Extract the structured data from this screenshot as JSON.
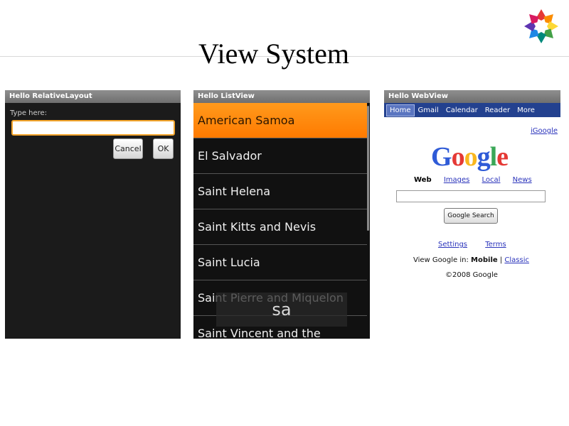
{
  "slide": {
    "title": "View System"
  },
  "relative_layout": {
    "title": "Hello RelativeLayout",
    "label": "Type here:",
    "input_value": "",
    "cancel_label": "Cancel",
    "ok_label": "OK"
  },
  "list_view": {
    "title": "Hello ListView",
    "items": [
      "American Samoa",
      "El Salvador",
      "Saint Helena",
      "Saint Kitts and Nevis",
      "Saint Lucia",
      "Saint Pierre and Miquelon",
      "Saint Vincent and the"
    ],
    "selected_item": "American Samoa",
    "filter_popup": "sa"
  },
  "web_view": {
    "title": "Hello WebView",
    "nav": [
      "Home",
      "Gmail",
      "Calendar",
      "Reader",
      "More"
    ],
    "igoogle": "iGoogle",
    "logo": "Google",
    "tabs": [
      "Web",
      "Images",
      "Local",
      "News"
    ],
    "search_value": "",
    "search_button": "Google Search",
    "links": [
      "Settings",
      "Terms"
    ],
    "view_prefix": "View Google in:",
    "view_mobile": "Mobile",
    "view_sep": "|",
    "view_classic": "Classic",
    "copyright": "©2008 Google"
  },
  "colors": {
    "selection": "#ff8c00",
    "nav_bar": "#23418f",
    "link": "#2a33bb",
    "input_focus": "#f3a42b"
  }
}
